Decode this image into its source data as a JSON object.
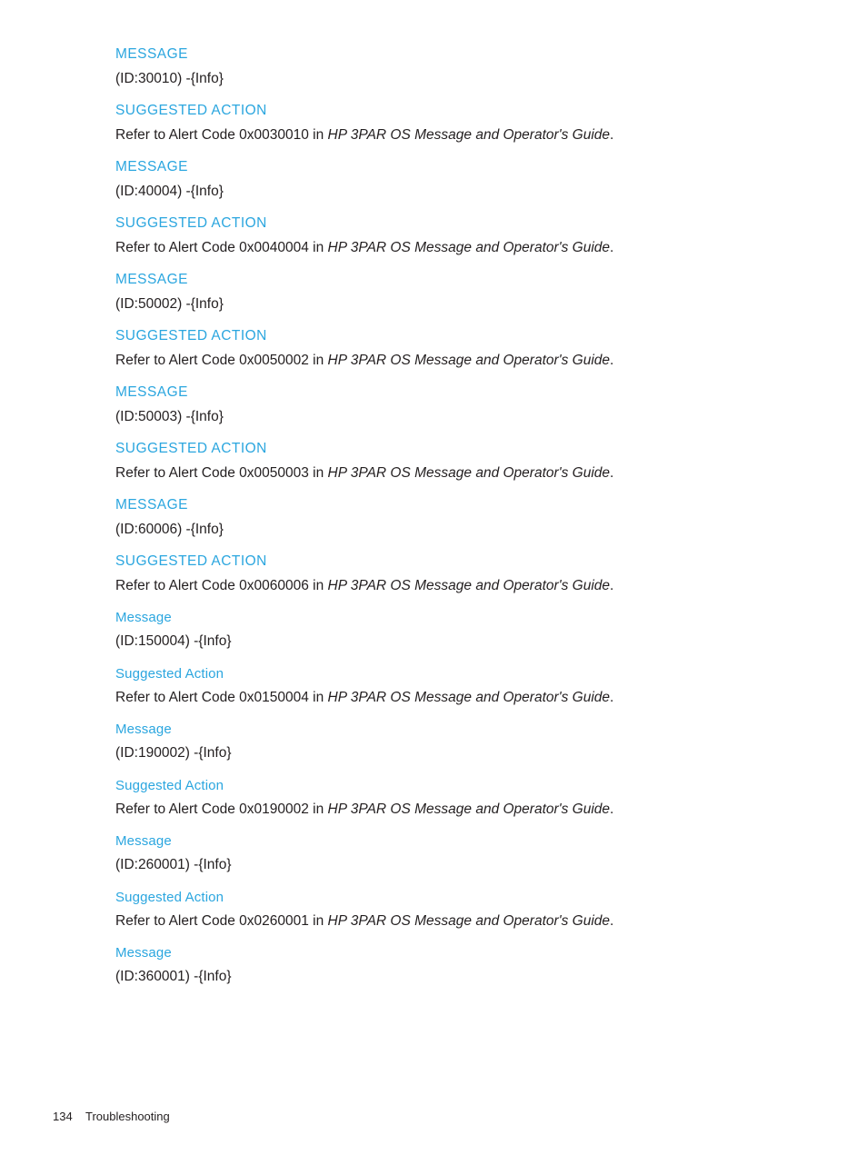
{
  "document": {
    "page_number": "134",
    "section_name": "Troubleshooting",
    "heading_color": "#2ba6df",
    "body_color": "#231f20",
    "background_color": "#ffffff"
  },
  "entries": [
    {
      "message_heading": "MESSAGE",
      "message_text": "(ID:30010) -{Info}",
      "action_heading": "SUGGESTED ACTION",
      "action_prefix": "Refer to Alert Code 0x0030010 in ",
      "action_reference": "HP 3PAR OS Message and Operator's Guide",
      "action_suffix": ".",
      "heading_style": "upper"
    },
    {
      "message_heading": "MESSAGE",
      "message_text": "(ID:40004) -{Info}",
      "action_heading": "SUGGESTED ACTION",
      "action_prefix": "Refer to Alert Code 0x0040004 in ",
      "action_reference": "HP 3PAR OS Message and Operator's Guide",
      "action_suffix": ".",
      "heading_style": "upper"
    },
    {
      "message_heading": "MESSAGE",
      "message_text": "(ID:50002) -{Info}",
      "action_heading": "SUGGESTED ACTION",
      "action_prefix": "Refer to Alert Code 0x0050002 in ",
      "action_reference": "HP 3PAR OS Message and Operator's Guide",
      "action_suffix": ".",
      "heading_style": "upper"
    },
    {
      "message_heading": "MESSAGE",
      "message_text": "(ID:50003) -{Info}",
      "action_heading": "SUGGESTED ACTION",
      "action_prefix": "Refer to Alert Code 0x0050003 in ",
      "action_reference": "HP 3PAR OS Message and Operator's Guide",
      "action_suffix": ".",
      "heading_style": "upper"
    },
    {
      "message_heading": "MESSAGE",
      "message_text": "(ID:60006) -{Info}",
      "action_heading": "SUGGESTED ACTION",
      "action_prefix": "Refer to Alert Code 0x0060006 in ",
      "action_reference": "HP 3PAR OS Message and Operator's Guide",
      "action_suffix": ".",
      "heading_style": "upper"
    },
    {
      "message_heading": "Message",
      "message_text": "(ID:150004) -{Info}",
      "action_heading": "Suggested Action",
      "action_prefix": "Refer to Alert Code 0x0150004 in ",
      "action_reference": "HP 3PAR OS Message and Operator's Guide",
      "action_suffix": ".",
      "heading_style": "title"
    },
    {
      "message_heading": "Message",
      "message_text": "(ID:190002) -{Info}",
      "action_heading": "Suggested Action",
      "action_prefix": "Refer to Alert Code 0x0190002 in ",
      "action_reference": "HP 3PAR OS Message and Operator's Guide",
      "action_suffix": ".",
      "heading_style": "title"
    },
    {
      "message_heading": "Message",
      "message_text": "(ID:260001) -{Info}",
      "action_heading": "Suggested Action",
      "action_prefix": "Refer to Alert Code 0x0260001 in ",
      "action_reference": "HP 3PAR OS Message and Operator's Guide",
      "action_suffix": ".",
      "heading_style": "title"
    },
    {
      "message_heading": "Message",
      "message_text": "(ID:360001) -{Info}",
      "action_heading": null,
      "action_prefix": null,
      "action_reference": null,
      "action_suffix": null,
      "heading_style": "title"
    }
  ]
}
